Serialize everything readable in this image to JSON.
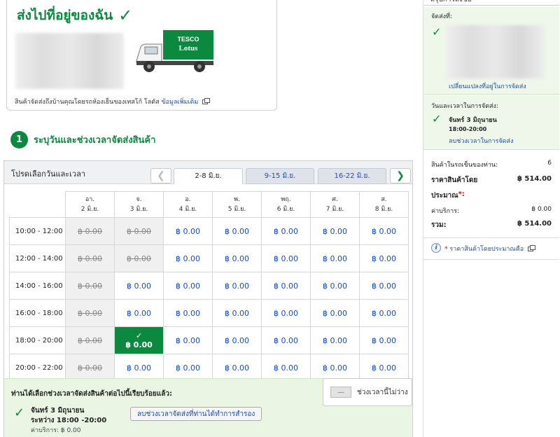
{
  "delivery": {
    "title": "ส่งไปที่อยู่ของฉัน",
    "truck_brand_top": "TESCO",
    "truck_brand_bottom": "Lotus",
    "note": "สินค้าจัดส่งถึงบ้านคุณโดยรถห้องเย็นของเทสโก้ โลตัส",
    "more_info": "ข้อมูลเพิ่มเติม"
  },
  "step": {
    "number": "1",
    "label": "ระบุวันและช่วงเวลาจัดส่งสินค้า"
  },
  "slot_panel": {
    "title": "โปรดเลือกวันและเวลา",
    "prev_icon": "❮",
    "next_icon": "❯",
    "weeks": [
      "2-8 มิ.ย.",
      "9-15 มิ.ย.",
      "16-22 มิ.ย."
    ],
    "days": [
      {
        "day": "อา.",
        "date": "2 มิ.ย."
      },
      {
        "day": "จ.",
        "date": "3 มิ.ย."
      },
      {
        "day": "อ.",
        "date": "4 มิ.ย."
      },
      {
        "day": "พ.",
        "date": "5 มิ.ย."
      },
      {
        "day": "พฤ.",
        "date": "6 มิ.ย."
      },
      {
        "day": "ศ.",
        "date": "7 มิ.ย."
      },
      {
        "day": "ส.",
        "date": "8 มิ.ย."
      }
    ],
    "rows": [
      {
        "time": "10:00 - 12:00",
        "cells": [
          "u",
          "u",
          "a",
          "a",
          "a",
          "a",
          "a"
        ]
      },
      {
        "time": "12:00 - 14:00",
        "cells": [
          "u",
          "u",
          "a",
          "a",
          "a",
          "a",
          "a"
        ]
      },
      {
        "time": "14:00 - 16:00",
        "cells": [
          "u",
          "a",
          "a",
          "a",
          "a",
          "a",
          "a"
        ]
      },
      {
        "time": "16:00 - 18:00",
        "cells": [
          "u",
          "a",
          "a",
          "a",
          "a",
          "a",
          "a"
        ]
      },
      {
        "time": "18:00 - 20:00",
        "cells": [
          "u",
          "s",
          "a",
          "a",
          "a",
          "a",
          "a"
        ]
      },
      {
        "time": "20:00 - 22:00",
        "cells": [
          "u",
          "a",
          "a",
          "a",
          "a",
          "a",
          "a"
        ]
      }
    ],
    "price": "฿ 0.00",
    "selected_check": "✓"
  },
  "confirm": {
    "heading": "ท่านได้เลือกช่วงเวลาจัดส่งสินค้าต่อไปนี้เรียบร้อยแล้ว:",
    "date": "จันทร์ 3 มิถุนายน",
    "range": "ระหว่าง 18:00 -20:00",
    "fee": "ค่าบริการ: ฿ 0.00",
    "remove_button": "ลบช่วงเวลาจัดส่งที่ท่านได้ทำการสำรอง",
    "legend_label": "ช่วงเวลานี้ไม่ว่าง",
    "legend_swatch": "—"
  },
  "sidebar": {
    "header": "สรุปการสั่งซื้อ",
    "ship_to_label": "จัดส่งที่:",
    "change_address": "เปลี่ยนแปลงที่อยู่ในการจัดส่ง",
    "slot_label": "วันและเวลาในการจัดส่ง:",
    "slot_date": "จันทร์ 3 มิถุนายน",
    "slot_time": "18:00-20:00",
    "remove_slot": "ลบช่วงเวลาในการจัดส่ง",
    "items_label": "สินค้าในรถเข็นของท่าน:",
    "items_count": "6",
    "price_label": "ราคาสินค้าโดย",
    "price_value": "฿ 514.00",
    "approx_label": "ประมาณ",
    "approx_star": "*:",
    "service_label": "ค่าบริการ:",
    "service_value": "฿ 0.00",
    "total_label": "รวม:",
    "total_value": "฿ 514.00",
    "info_icon": "i",
    "info_star": "*",
    "info_text": "ราคาสินค้าโดยประมาณคือ"
  },
  "colors": {
    "brand_green": "#0b8a3f",
    "link_blue": "#1a4db3",
    "confirm_bg": "#eaf5e4",
    "unavailable_bg": "#f0f0f0"
  }
}
